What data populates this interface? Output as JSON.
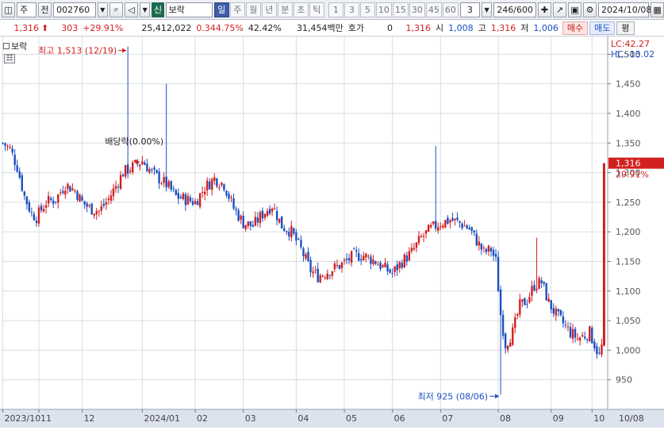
{
  "toolbar": {
    "market": "주",
    "prev_label": "전",
    "code": "002760",
    "stock_tag": "신",
    "stock_name": "보락",
    "periods": [
      "일",
      "주",
      "월",
      "년",
      "분",
      "초",
      "틱"
    ],
    "active_period": "일",
    "intervals": [
      "1",
      "3",
      "5",
      "10",
      "15",
      "30",
      "45",
      "60"
    ],
    "custom_interval": "3",
    "count": "246/600",
    "date": "2024/10/08"
  },
  "quote": {
    "price": "1,316",
    "change": "303",
    "change_pct": "+29.91%",
    "volume": "25,412,022",
    "volume_ratio": "0.344.75%",
    "turnover": "42.42%",
    "amount": "31,454백만",
    "hoga_label": "호가",
    "hoga_value": "0",
    "hoga_price": "1,316",
    "open_label": "시",
    "open": "1,008",
    "high_label": "고",
    "high": "1,316",
    "low_label": "저",
    "low": "1,006",
    "buy_label": "매수",
    "sell_label": "매도",
    "eval_label": "평"
  },
  "legend": {
    "name": "보락",
    "lc": "LC:42.27",
    "hc": "HC:-13.02"
  },
  "annotations": {
    "high": "최고 1,513 (12/19)",
    "low": "최저 925 (08/06)",
    "dividend": "배당락(0.00%)",
    "last_price": "1,316",
    "last_pct": "29.91%"
  },
  "chart_data": {
    "type": "candlestick",
    "ylim": [
      900,
      1530
    ],
    "y_ticks": [
      1500,
      1450,
      1400,
      1350,
      1300,
      1250,
      1200,
      1150,
      1100,
      1050,
      1000,
      950
    ],
    "y_tick_labels": [
      "1,500",
      "1,450",
      "1,400",
      "1,350",
      "1,300",
      "1,250",
      "1,200",
      "1,150",
      "1,100",
      "1,050",
      "1,000",
      "950"
    ],
    "x_labels": [
      "2023/10",
      "11",
      "12",
      "2024/01",
      "02",
      "03",
      "04",
      "05",
      "06",
      "07",
      "08",
      "09",
      "10",
      "10/08"
    ],
    "x_label_index": [
      0,
      15,
      33,
      58,
      80,
      100,
      122,
      142,
      162,
      182,
      206,
      228,
      245,
      259
    ],
    "n": 246,
    "price_path": [
      [
        0,
        1350
      ],
      [
        3,
        1340
      ],
      [
        6,
        1310
      ],
      [
        9,
        1260
      ],
      [
        12,
        1230
      ],
      [
        14,
        1225
      ],
      [
        18,
        1250
      ],
      [
        22,
        1255
      ],
      [
        26,
        1280
      ],
      [
        30,
        1270
      ],
      [
        33,
        1250
      ],
      [
        36,
        1240
      ],
      [
        40,
        1235
      ],
      [
        44,
        1255
      ],
      [
        50,
        1300
      ],
      [
        54,
        1310
      ],
      [
        58,
        1320
      ],
      [
        62,
        1300
      ],
      [
        68,
        1280
      ],
      [
        72,
        1260
      ],
      [
        76,
        1255
      ],
      [
        80,
        1250
      ],
      [
        84,
        1275
      ],
      [
        88,
        1290
      ],
      [
        92,
        1280
      ],
      [
        96,
        1240
      ],
      [
        100,
        1215
      ],
      [
        104,
        1210
      ],
      [
        108,
        1230
      ],
      [
        112,
        1245
      ],
      [
        116,
        1210
      ],
      [
        120,
        1200
      ],
      [
        124,
        1170
      ],
      [
        128,
        1135
      ],
      [
        131,
        1125
      ],
      [
        136,
        1135
      ],
      [
        141,
        1145
      ],
      [
        146,
        1160
      ],
      [
        150,
        1160
      ],
      [
        155,
        1150
      ],
      [
        158,
        1140
      ],
      [
        162,
        1130
      ],
      [
        166,
        1150
      ],
      [
        170,
        1165
      ],
      [
        174,
        1190
      ],
      [
        178,
        1205
      ],
      [
        182,
        1215
      ],
      [
        186,
        1220
      ],
      [
        190,
        1215
      ],
      [
        194,
        1205
      ],
      [
        197,
        1185
      ],
      [
        200,
        1165
      ],
      [
        203,
        1170
      ],
      [
        205,
        1150
      ],
      [
        207,
        1060
      ],
      [
        209,
        1010
      ],
      [
        212,
        1030
      ],
      [
        215,
        1075
      ],
      [
        218,
        1085
      ],
      [
        221,
        1110
      ],
      [
        224,
        1115
      ],
      [
        227,
        1080
      ],
      [
        230,
        1060
      ],
      [
        233,
        1045
      ],
      [
        236,
        1030
      ],
      [
        239,
        1020
      ],
      [
        242,
        1025
      ],
      [
        244,
        1030
      ],
      [
        246,
        1010
      ],
      [
        247,
        1000
      ],
      [
        248,
        990
      ],
      [
        249,
        1006
      ]
    ],
    "highlight_wicks": [
      {
        "i": 52,
        "value": 1513
      },
      {
        "i": 68,
        "value": 1450
      },
      {
        "i": 180,
        "value": 1345
      },
      {
        "i": 222,
        "value": 1190
      },
      {
        "i": 207,
        "value": 925
      }
    ],
    "last_candle": {
      "i": 250,
      "open": 1008,
      "high": 1316,
      "low": 1006,
      "close": 1316
    }
  }
}
